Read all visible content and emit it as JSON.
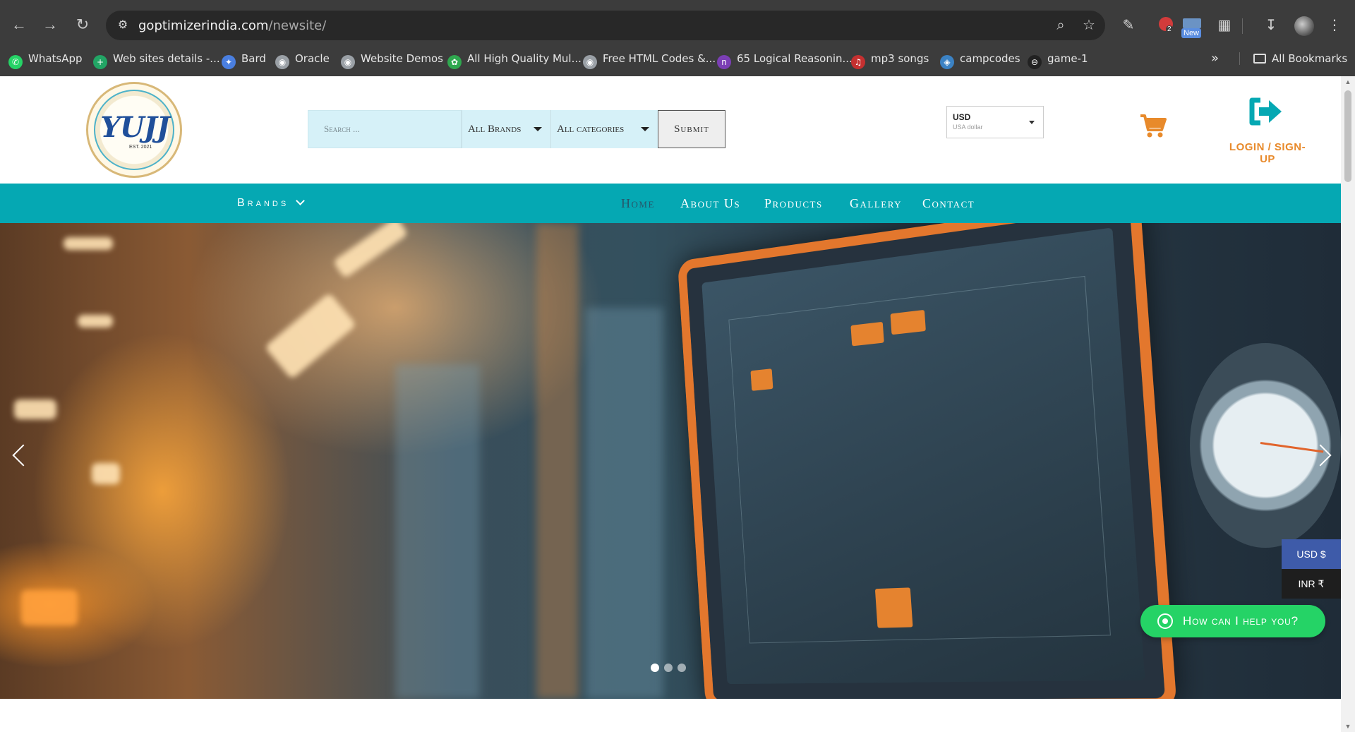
{
  "browser": {
    "url_host": "goptimizerindia.com",
    "url_path": "/newsite/",
    "extension_badge_count": "2",
    "new_badge": "New"
  },
  "bookmarks": [
    {
      "label": "WhatsApp",
      "icon": "whatsapp-icon",
      "color": "#25d366"
    },
    {
      "label": "Web sites details -...",
      "icon": "sheets-icon",
      "color": "#22a565"
    },
    {
      "label": "Bard",
      "icon": "bard-icon",
      "color": "#4a7fe0"
    },
    {
      "label": "Oracle",
      "icon": "globe-icon",
      "color": "#9aa0a6"
    },
    {
      "label": "Website Demos",
      "icon": "globe-icon",
      "color": "#9aa0a6"
    },
    {
      "label": "All High Quality Mul...",
      "icon": "leaf-icon",
      "color": "#2fa84f"
    },
    {
      "label": "Free HTML Codes &...",
      "icon": "globe-icon",
      "color": "#9aa0a6"
    },
    {
      "label": "65 Logical Reasonin...",
      "icon": "n-icon",
      "color": "#7b3fb5"
    },
    {
      "label": "mp3 songs",
      "icon": "music-icon",
      "color": "#c53030"
    },
    {
      "label": "campcodes",
      "icon": "shield-icon",
      "color": "#3b82c4"
    },
    {
      "label": "game-1",
      "icon": "target-icon",
      "color": "#222222"
    }
  ],
  "all_bookmarks_label": "All Bookmarks",
  "header": {
    "logo_text": "YUJJ",
    "logo_est": "EST. 2021",
    "search_placeholder": "Search ...",
    "brands_select": "All Brands",
    "categories_select": "All categories",
    "submit_label": "Submit",
    "currency_code": "USD",
    "currency_name": "USA dollar",
    "login_label": "LOGIN / SIGN-UP"
  },
  "nav": {
    "brands": "Brands",
    "items": [
      "Home",
      "About Us",
      "Products",
      "Gallery",
      "Contact"
    ],
    "active": "Home"
  },
  "hero": {
    "slide_count": 3,
    "active_slide": 1
  },
  "currency_switch": {
    "usd": "USD $",
    "inr": "INR ₹"
  },
  "whatsapp_cta": "How can I help you?",
  "colors": {
    "teal": "#05a8b3",
    "orange": "#e88a2b",
    "whatsapp": "#25d366",
    "usd_blue": "#3e5ba9"
  }
}
